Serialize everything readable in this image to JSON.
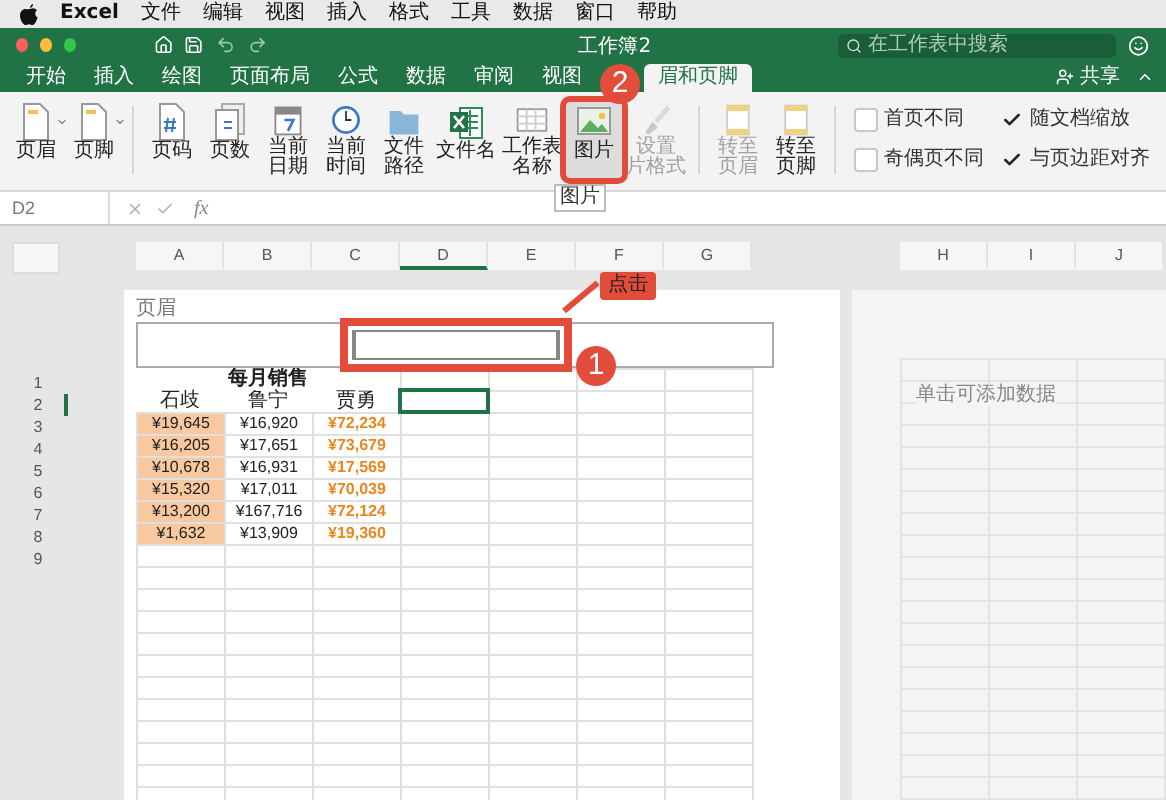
{
  "menu_bar": {
    "app": "Excel",
    "items": [
      "文件",
      "编辑",
      "视图",
      "插入",
      "格式",
      "工具",
      "数据",
      "窗口",
      "帮助"
    ]
  },
  "title_bar": {
    "title": "工作簿2",
    "search": {
      "placeholder": "在工作表中搜索"
    }
  },
  "tabs": [
    {
      "label": "开始",
      "selected": false
    },
    {
      "label": "插入",
      "selected": false
    },
    {
      "label": "绘图",
      "selected": false
    },
    {
      "label": "页面布局",
      "selected": false
    },
    {
      "label": "公式",
      "selected": false
    },
    {
      "label": "数据",
      "selected": false
    },
    {
      "label": "审阅",
      "selected": false
    },
    {
      "label": "视图",
      "selected": false
    },
    {
      "label": "眉和页脚",
      "selected": true
    }
  ],
  "share": {
    "label": "共享"
  },
  "ribbon": {
    "buttons": [
      {
        "kind": "page",
        "lines": [
          "页眉"
        ],
        "dropdown": true,
        "disabled": false,
        "pressed": false,
        "annotated": false
      },
      {
        "kind": "page",
        "lines": [
          "页脚"
        ],
        "dropdown": true,
        "disabled": false,
        "pressed": false,
        "annotated": false
      },
      {
        "kind": "number",
        "lines": [
          "页码"
        ],
        "dropdown": false,
        "disabled": false,
        "pressed": false,
        "annotated": false
      },
      {
        "kind": "pages",
        "lines": [
          "页数"
        ],
        "dropdown": false,
        "disabled": false,
        "pressed": false,
        "annotated": false
      },
      {
        "kind": "date",
        "lines": [
          "当前",
          "日期"
        ],
        "dropdown": false,
        "disabled": false,
        "pressed": false,
        "annotated": false
      },
      {
        "kind": "time",
        "lines": [
          "当前",
          "时间"
        ],
        "dropdown": false,
        "disabled": false,
        "pressed": false,
        "annotated": false
      },
      {
        "kind": "path",
        "lines": [
          "文件",
          "路径"
        ],
        "dropdown": false,
        "disabled": false,
        "pressed": false,
        "annotated": false
      },
      {
        "kind": "filename",
        "lines": [
          "文件名"
        ],
        "dropdown": false,
        "disabled": false,
        "pressed": false,
        "annotated": false
      },
      {
        "kind": "sheetname",
        "lines": [
          "工作表",
          "名称"
        ],
        "dropdown": false,
        "disabled": false,
        "pressed": false,
        "annotated": false
      },
      {
        "kind": "picture",
        "lines": [
          "图片"
        ],
        "dropdown": false,
        "disabled": false,
        "pressed": true,
        "annotated": true
      },
      {
        "kind": "format",
        "lines": [
          "设置",
          "片格式"
        ],
        "dropdown": false,
        "disabled": true,
        "pressed": false,
        "annotated": false
      },
      {
        "kind": "goto",
        "lines": [
          "转至",
          "页眉"
        ],
        "dropdown": false,
        "disabled": true,
        "pressed": false,
        "annotated": false
      },
      {
        "kind": "goto",
        "lines": [
          "转至",
          "页脚"
        ],
        "dropdown": false,
        "disabled": false,
        "pressed": false,
        "annotated": false
      }
    ],
    "tooltip": "图片",
    "checkboxes": [
      {
        "label": "首页不同",
        "checked": false
      },
      {
        "label": "随文档缩放",
        "checked": true
      },
      {
        "label": "奇偶页不同",
        "checked": false
      },
      {
        "label": "与页边距对齐",
        "checked": true
      }
    ]
  },
  "formula_bar": {
    "cell_ref": "D2",
    "function_symbol": "fx"
  },
  "sheet": {
    "columns_left": [
      {
        "label": "A",
        "selected": false
      },
      {
        "label": "B",
        "selected": false
      },
      {
        "label": "C",
        "selected": false
      },
      {
        "label": "D",
        "selected": true
      },
      {
        "label": "E",
        "selected": false
      },
      {
        "label": "F",
        "selected": false
      },
      {
        "label": "G",
        "selected": false
      }
    ],
    "columns_right": [
      {
        "label": "H",
        "selected": false
      },
      {
        "label": "I",
        "selected": false
      },
      {
        "label": "J",
        "selected": false
      }
    ],
    "row_numbers": [
      {
        "label": "1",
        "selected": false
      },
      {
        "label": "2",
        "selected": true
      },
      {
        "label": "3",
        "selected": false
      },
      {
        "label": "4",
        "selected": false
      },
      {
        "label": "5",
        "selected": false
      },
      {
        "label": "6",
        "selected": false
      },
      {
        "label": "7",
        "selected": false
      },
      {
        "label": "8",
        "selected": false
      },
      {
        "label": "9",
        "selected": false
      }
    ],
    "header_label": "页眉",
    "header_annotated": true,
    "title": "每月销售",
    "header_row": [
      "石歧",
      "鲁宁",
      "贾勇"
    ],
    "rows": [
      [
        "¥19,645",
        "¥16,920",
        "¥72,234"
      ],
      [
        "¥16,205",
        "¥17,651",
        "¥73,679"
      ],
      [
        "¥10,678",
        "¥16,931",
        "¥17,569"
      ],
      [
        "¥15,320",
        "¥17,011",
        "¥70,039"
      ],
      [
        "¥13,200",
        "¥167,716",
        "¥72,124"
      ],
      [
        "¥1,632",
        "¥13,909",
        "¥19,360"
      ]
    ],
    "right_placeholder": "单击可添加数据"
  },
  "annotations": {
    "header_badge": "1",
    "header_callout": "点击",
    "ribbon_badge": "2"
  }
}
